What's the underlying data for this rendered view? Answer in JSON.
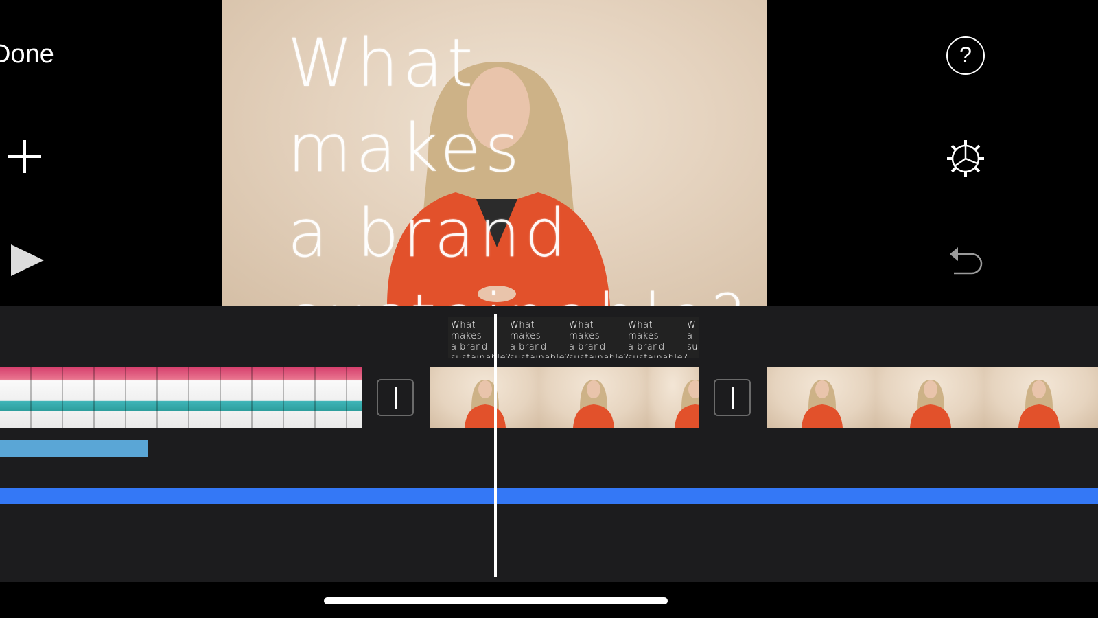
{
  "toolbar": {
    "done_label": "Done",
    "add_icon": "plus-icon",
    "play_icon": "play-icon",
    "help_label": "?",
    "settings_icon": "gear-icon",
    "undo_icon": "undo-icon"
  },
  "viewer": {
    "overlay_text": "What makes\na brand\nsustainable?"
  },
  "timeline": {
    "title_thumbnails": [
      "What makes\na brand\nsustainable?",
      "What makes\na brand\nsustainable?",
      "What makes\na brand\nsustainable?",
      "What makes\na brand\nsustainable?",
      "W\na\nsu"
    ],
    "colors": {
      "audio_track_1": "#5aa6d6",
      "audio_track_2": "#3478f6",
      "timeline_bg": "#1c1c1e",
      "playhead": "#ffffff"
    }
  }
}
